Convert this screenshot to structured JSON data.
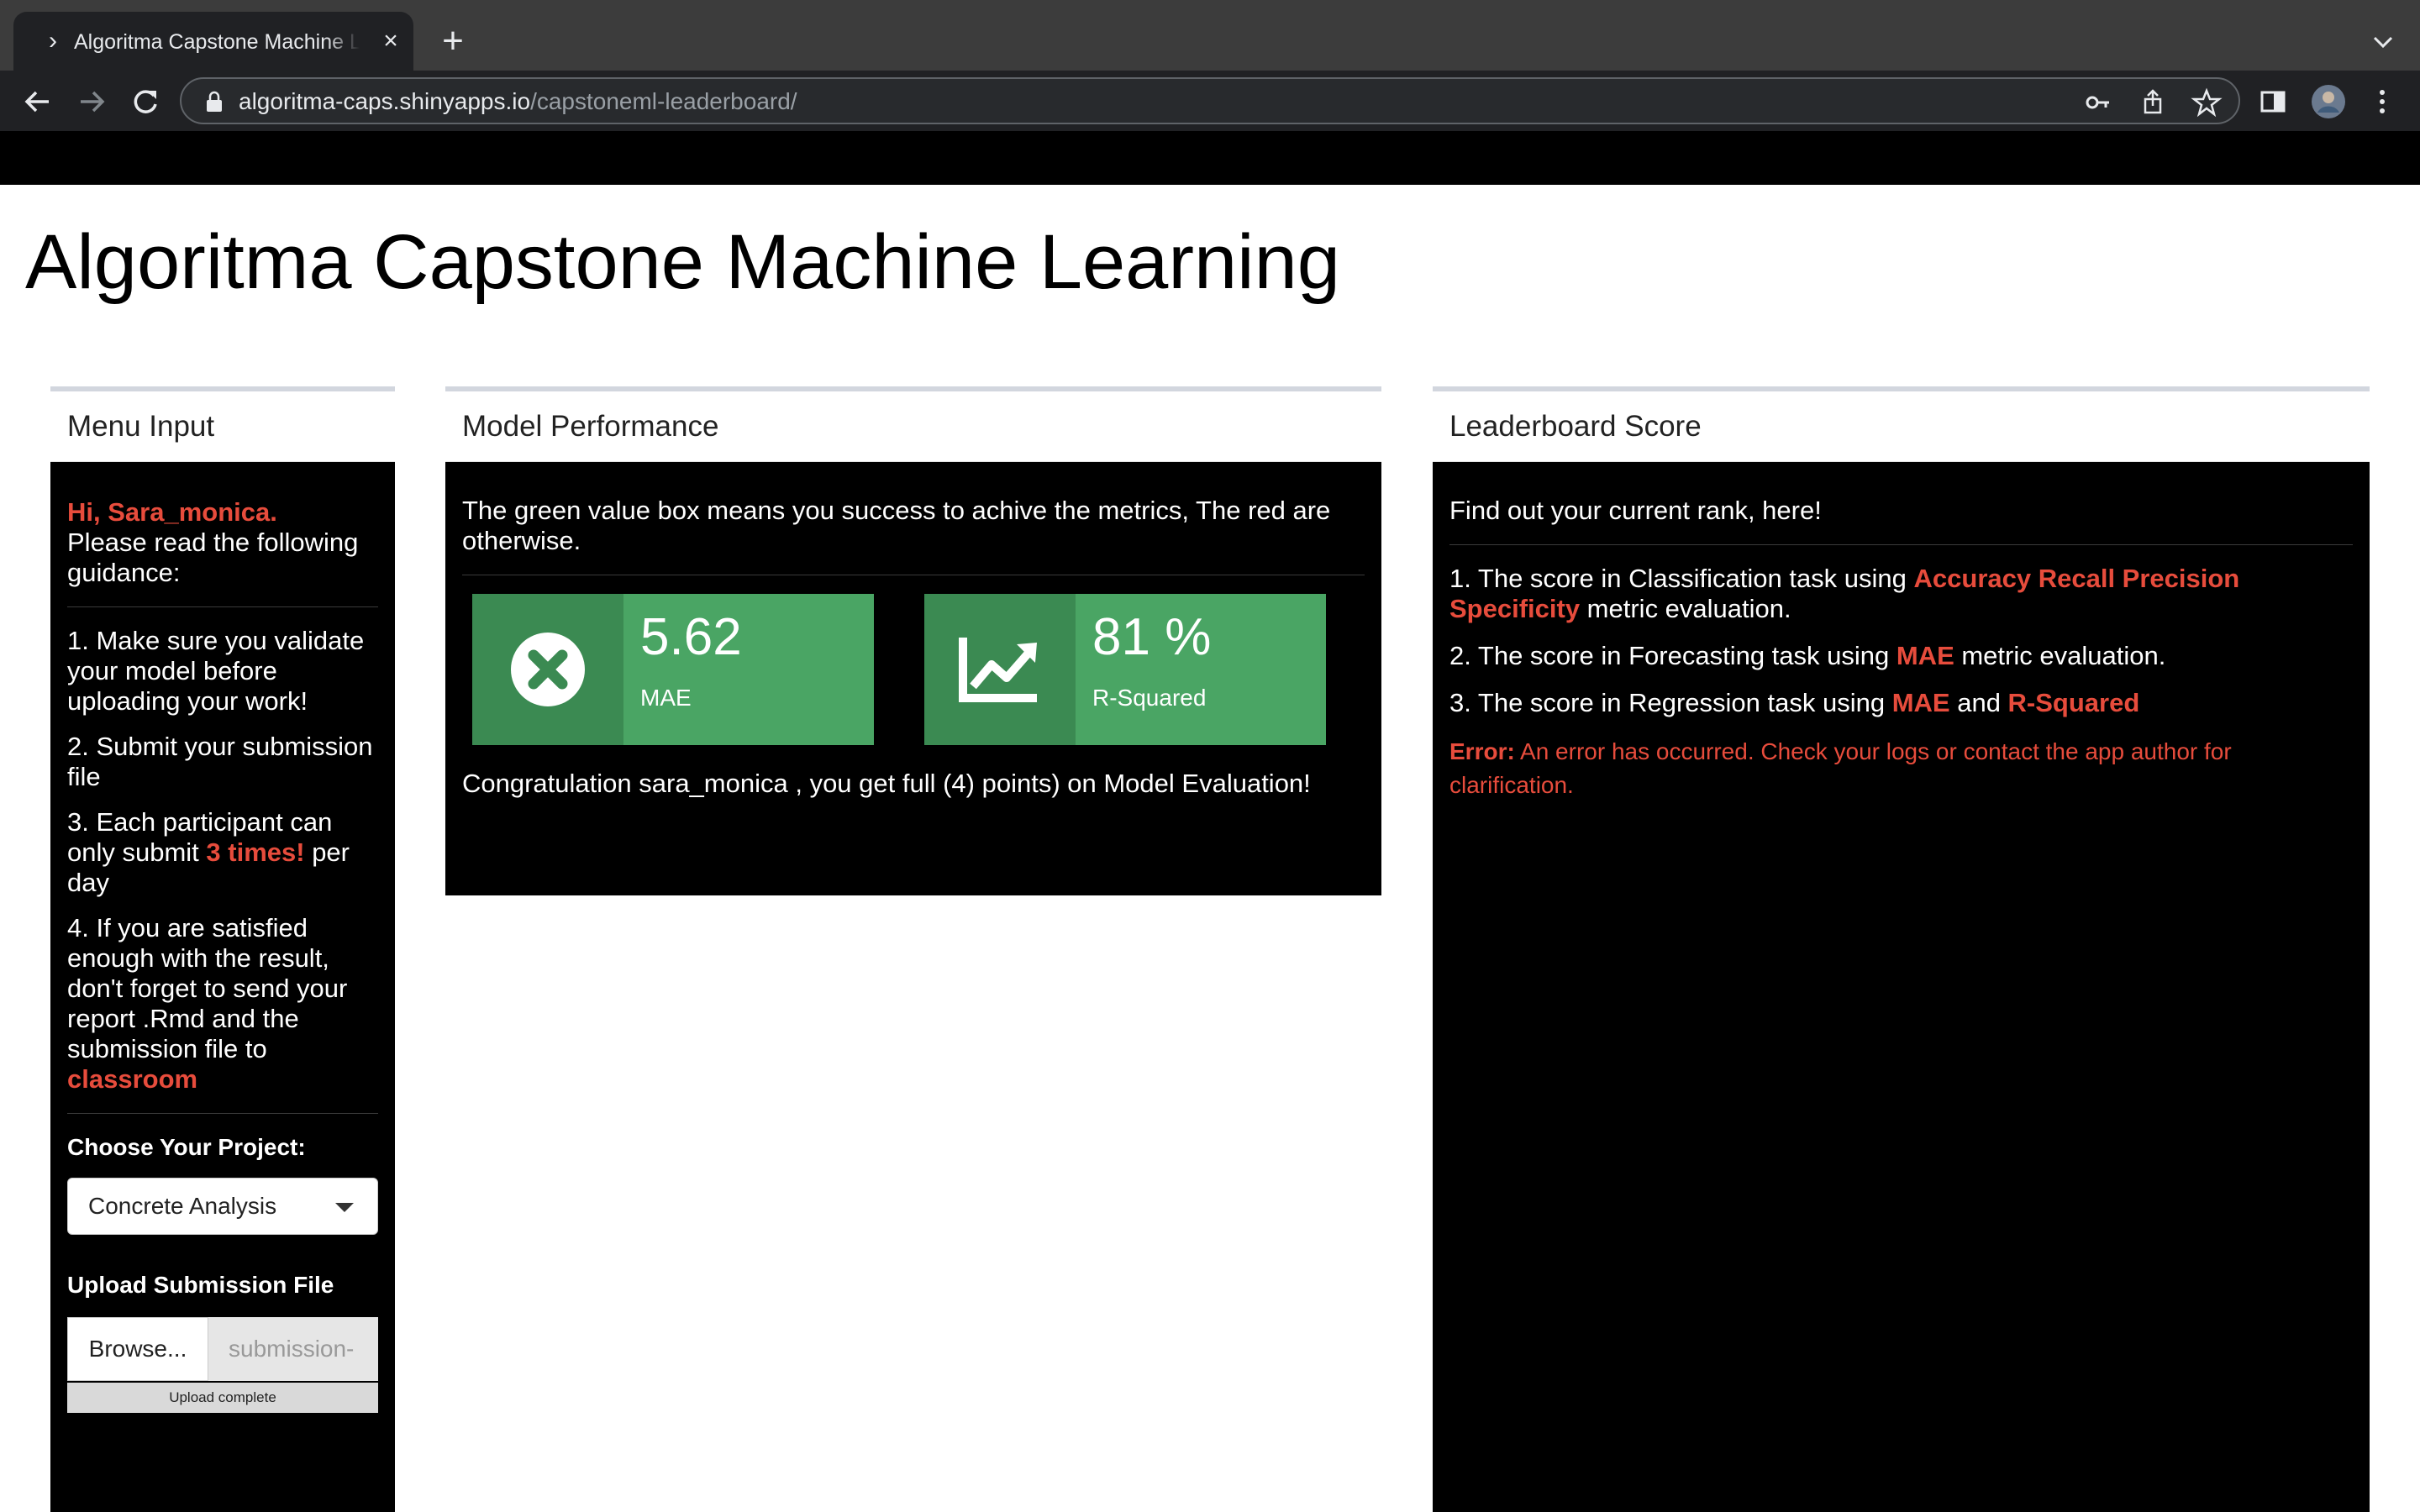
{
  "browser": {
    "tab_title": "Algoritma Capstone Machine Learning Leaderboard",
    "url_host": "algoritma-caps.shinyapps.io",
    "url_path": "/capstoneml-leaderboard/"
  },
  "page": {
    "title": "Algoritma Capstone Machine Learning"
  },
  "menu": {
    "header": "Menu Input",
    "greeting": "Hi, Sara_monica.",
    "intro": "Please read the following guidance:",
    "item1": "1. Make sure you validate your model before uploading your work!",
    "item2": "2. Submit your submission file",
    "item3_pre": "3. Each participant can only submit ",
    "item3_em": "3 times!",
    "item3_post": " per day",
    "item4_pre": "4. If you are satisfied enough with the result, don't forget to send your report .Rmd and the submission file to ",
    "item4_em": "classroom",
    "project_label": "Choose Your Project:",
    "project_value": "Concrete Analysis",
    "upload_label": "Upload Submission File",
    "browse_label": "Browse...",
    "file_name": "submission-",
    "upload_status": "Upload complete"
  },
  "performance": {
    "header": "Model Performance",
    "info": "The green value box means you success to achive the metrics, The red are otherwise.",
    "boxes": [
      {
        "value": "5.62",
        "label": "MAE",
        "icon": "times-circle-icon",
        "color": "#4aa564"
      },
      {
        "value": "81 %",
        "label": "R-Squared",
        "icon": "chart-line-icon",
        "color": "#4aa564"
      }
    ],
    "congrats": "Congratulation sara_monica , you get full (4) points) on Model Evaluation!"
  },
  "leaderboard": {
    "header": "Leaderboard Score",
    "intro": "Find out your current rank, here!",
    "item1_pre": "1. The score in Classification task using ",
    "item1_em": "Accuracy Recall Precision Specificity",
    "item1_post": " metric evaluation.",
    "item2_pre": "2. The score in Forecasting task using ",
    "item2_em": "MAE",
    "item2_post": " metric evaluation.",
    "item3_pre": "3. The score in Regression task using ",
    "item3_em1": "MAE",
    "item3_mid": " and ",
    "item3_em2": "R-Squared",
    "error_label": "Error:",
    "error_text": " An error has occurred. Check your logs or contact the app author for clarification."
  },
  "colors": {
    "accent_red": "#e74c3c",
    "success_green": "#4aa564",
    "panel_bg": "#000000"
  }
}
